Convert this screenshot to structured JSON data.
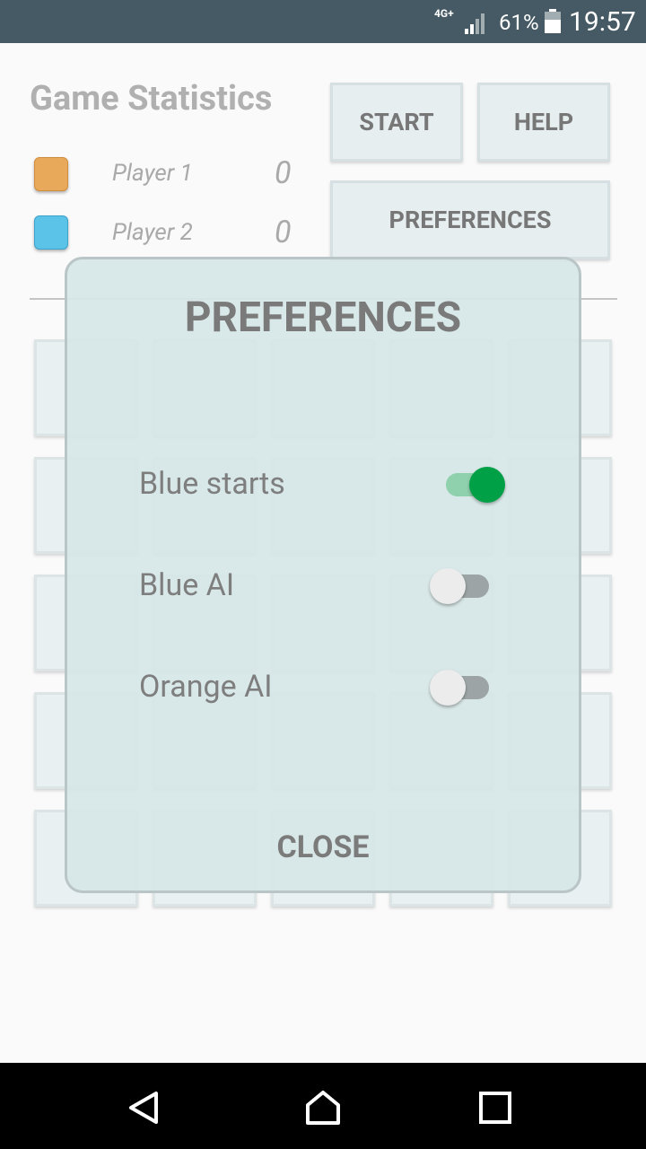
{
  "status_bar": {
    "network": "4G+",
    "battery_percent": "61%",
    "time": "19:57",
    "icons": [
      "signal-icon",
      "battery-icon"
    ]
  },
  "game_statistics": {
    "title": "Game Statistics",
    "players": [
      {
        "name": "Player 1",
        "score": "0",
        "color": "#e9a95a"
      },
      {
        "name": "Player 2",
        "score": "0",
        "color": "#5cc3e8"
      }
    ]
  },
  "buttons": {
    "start": "START",
    "help": "HELP",
    "preferences": "PREFERENCES"
  },
  "board": {
    "rows": 5,
    "cols": 5
  },
  "preferences_dialog": {
    "title": "PREFERENCES",
    "options": [
      {
        "label": "Blue starts",
        "enabled": true
      },
      {
        "label": "Blue AI",
        "enabled": false
      },
      {
        "label": "Orange AI",
        "enabled": false
      }
    ],
    "close_label": "CLOSE",
    "accent_color": "#00a046"
  },
  "nav_bar": {
    "icons": [
      "back-icon",
      "home-icon",
      "recent-apps-icon"
    ]
  }
}
